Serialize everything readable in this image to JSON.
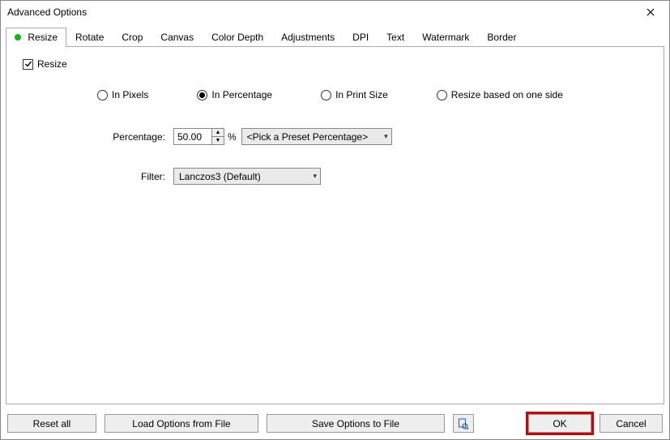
{
  "title": "Advanced Options",
  "tabs": [
    {
      "label": "Resize",
      "active_indicator": true
    },
    {
      "label": "Rotate"
    },
    {
      "label": "Crop"
    },
    {
      "label": "Canvas"
    },
    {
      "label": "Color Depth"
    },
    {
      "label": "Adjustments"
    },
    {
      "label": "DPI"
    },
    {
      "label": "Text"
    },
    {
      "label": "Watermark"
    },
    {
      "label": "Border"
    }
  ],
  "resize": {
    "enable_label": "Resize",
    "enable_checked": true,
    "modes": {
      "pixels": "In Pixels",
      "percentage": "In Percentage",
      "print_size": "In Print Size",
      "one_side": "Resize based on one side",
      "selected": "percentage"
    },
    "percentage_label": "Percentage:",
    "percentage_value": "50.00",
    "percentage_unit": "%",
    "preset_placeholder": "<Pick a Preset Percentage>",
    "filter_label": "Filter:",
    "filter_value": "Lanczos3 (Default)"
  },
  "buttons": {
    "reset": "Reset all",
    "load": "Load Options from File",
    "save": "Save Options to File",
    "ok": "OK",
    "cancel": "Cancel"
  }
}
